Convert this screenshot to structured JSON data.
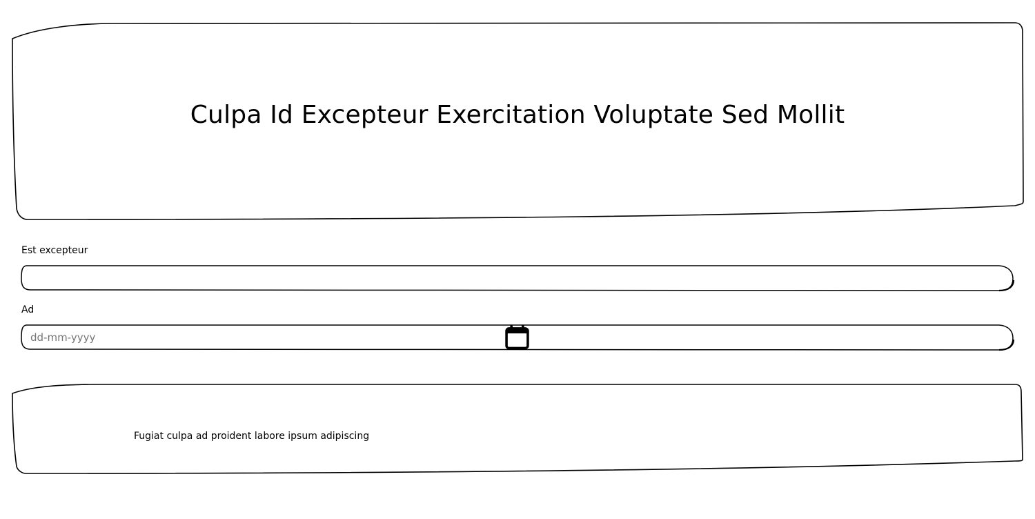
{
  "header": {
    "title": "Culpa Id Excepteur Exercitation Voluptate Sed Mollit"
  },
  "form": {
    "field_1": {
      "label": "Est excepteur",
      "value": ""
    },
    "field_2": {
      "label": "Ad",
      "placeholder": "dd-mm-yyyy",
      "icon": "calendar-icon"
    }
  },
  "footer": {
    "text": "Fugiat culpa ad proident labore ipsum adipiscing"
  }
}
